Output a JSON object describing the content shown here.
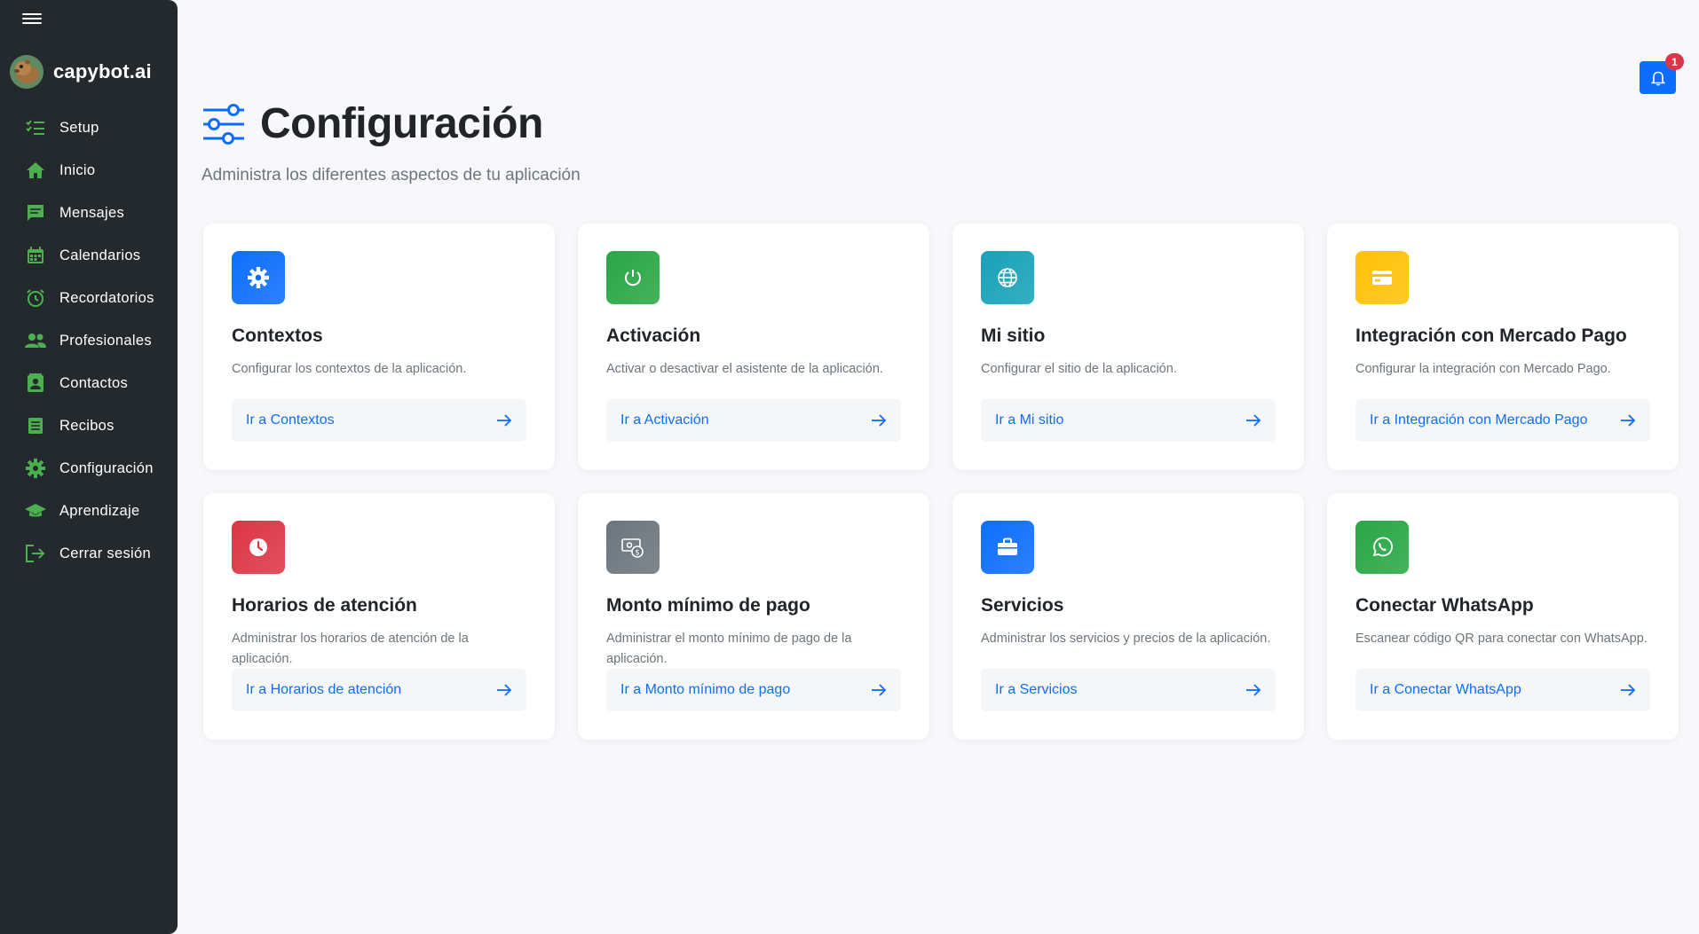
{
  "app": {
    "name": "capybot.ai"
  },
  "sidebar": {
    "items": [
      {
        "label": "Setup",
        "icon": "checklist-icon"
      },
      {
        "label": "Inicio",
        "icon": "home-icon"
      },
      {
        "label": "Mensajes",
        "icon": "message-icon"
      },
      {
        "label": "Calendarios",
        "icon": "calendar-icon"
      },
      {
        "label": "Recordatorios",
        "icon": "alarm-icon"
      },
      {
        "label": "Profesionales",
        "icon": "people-icon"
      },
      {
        "label": "Contactos",
        "icon": "contact-card-icon"
      },
      {
        "label": "Recibos",
        "icon": "receipt-icon"
      },
      {
        "label": "Configuración",
        "icon": "gear-icon"
      },
      {
        "label": "Aprendizaje",
        "icon": "graduation-cap-icon"
      },
      {
        "label": "Cerrar sesión",
        "icon": "logout-icon"
      }
    ],
    "icon_color": "#4caf50"
  },
  "notifications": {
    "count": "1"
  },
  "header": {
    "title": "Configuración",
    "subtitle": "Administra los diferentes aspectos de tu aplicación"
  },
  "cards": [
    {
      "title": "Contextos",
      "description": "Configurar los contextos de la aplicación.",
      "link": "Ir a Contextos",
      "icon": "gear-icon",
      "color": "#0d6efd"
    },
    {
      "title": "Activación",
      "description": "Activar o desactivar el asistente de la aplicación.",
      "link": "Ir a Activación",
      "icon": "power-icon",
      "color": "#28a745"
    },
    {
      "title": "Mi sitio",
      "description": "Configurar el sitio de la aplicación.",
      "link": "Ir a Mi sitio",
      "icon": "globe-icon",
      "color": "#17a2b8"
    },
    {
      "title": "Integración con Mercado Pago",
      "description": "Configurar la integración con Mercado Pago.",
      "link": "Ir a Integración con Mercado Pago",
      "icon": "credit-card-icon",
      "color": "#ffc107"
    },
    {
      "title": "Horarios de atención",
      "description": "Administrar los horarios de atención de la aplicación.",
      "link": "Ir a Horarios de atención",
      "icon": "clock-icon",
      "color": "#dc3545"
    },
    {
      "title": "Monto mínimo de pago",
      "description": "Administrar el monto mínimo de pago de la aplicación.",
      "link": "Ir a Monto mínimo de pago",
      "icon": "cash-coin-icon",
      "color": "#6c757d"
    },
    {
      "title": "Servicios",
      "description": "Administrar los servicios y precios de la aplicación.",
      "link": "Ir a Servicios",
      "icon": "briefcase-icon",
      "color": "#0d6efd"
    },
    {
      "title": "Conectar WhatsApp",
      "description": "Escanear código QR para conectar con WhatsApp.",
      "link": "Ir a Conectar WhatsApp",
      "icon": "whatsapp-icon",
      "color": "#28a745"
    }
  ]
}
